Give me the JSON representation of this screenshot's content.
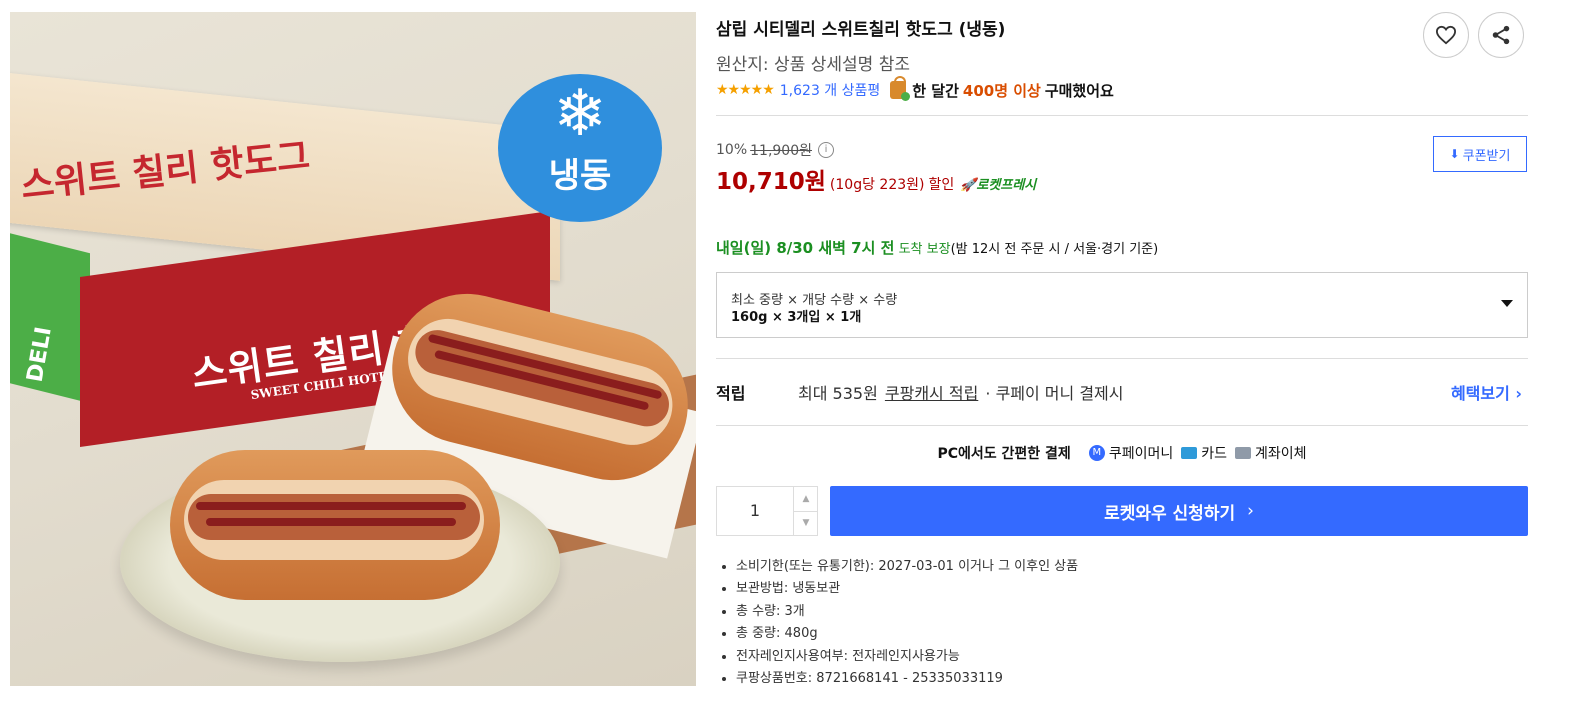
{
  "image": {
    "badge_text": "냉동",
    "box_top_title": "스위트 칠리 핫도그",
    "box_red_title": "스위트 칠리 핫도그",
    "box_red_sub": "SWEET CHILI HOTDOG",
    "box_side": "DELI"
  },
  "product": {
    "title": "삼립 시티델리 스위트칠리 핫도그 (냉동)",
    "origin": "원산지: 상품 상세설명 참조",
    "stars": "★★★★★",
    "review_count": "1,623 개 상품평",
    "buy_prefix": "한 달간",
    "buy_count": "400명 이상",
    "buy_suffix": "구매했어요"
  },
  "price": {
    "discount_rate": "10%",
    "original": "11,900원",
    "sale": "10,710원",
    "unit_price": "(10g당 223원)",
    "discount_word": "할인",
    "rocket_label": "🚀로켓프레시",
    "coupon_label": "쿠폰받기"
  },
  "delivery": {
    "date": "내일(일) 8/30 새벽 7시 전",
    "arrive": "도착 보장",
    "note": "(밤 12시 전 주문 시 / 서울·경기 기준)"
  },
  "option": {
    "label": "최소 중량 × 개당 수량 × 수량",
    "value": "160g × 3개입 × 1개"
  },
  "cash": {
    "label": "적립",
    "max": "최대 535원",
    "link": "쿠팡캐시 적립",
    "tail": "· 쿠페이 머니 결제시",
    "more": "혜택보기 ›"
  },
  "pay": {
    "title": "PC에서도 간편한 결제",
    "methods": [
      "쿠페이머니",
      "카드",
      "계좌이체"
    ]
  },
  "purchase": {
    "quantity": "1",
    "cta": "로켓와우 신청하기",
    "cta_chevron": "›"
  },
  "specs": [
    "소비기한(또는 유통기한): 2027-03-01 이거나 그 이후인 상품",
    "보관방법: 냉동보관",
    "총 수량: 3개",
    "총 중량: 480g",
    "전자레인지사용여부: 전자레인지사용가능",
    "쿠팡상품번호: 8721668141 - 25335033119"
  ],
  "colors": {
    "accent_blue": "#346aff",
    "price_red": "#ae0000",
    "delivery_green": "#1b8f21",
    "buy_orange": "#d94d00"
  }
}
